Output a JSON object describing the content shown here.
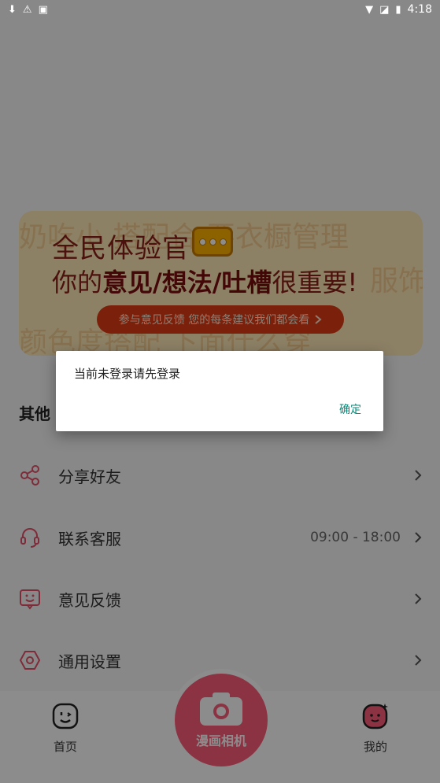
{
  "status_bar": {
    "time": "4:18"
  },
  "banner": {
    "bg_text_1": "奶吃小 搭配合 要衣橱管理",
    "bg_text_2": "颜色度搭配 下面什么穿",
    "bg_text_3": "服饰",
    "title": "全民体验官",
    "subtitle_prefix": "你的",
    "subtitle_emphasis": "意见/想法/吐槽",
    "subtitle_suffix": "很重要!",
    "cta": "参与意见反馈 您的每条建议我们都会看"
  },
  "section": {
    "title": "其他"
  },
  "menu": [
    {
      "label": "分享好友",
      "meta": ""
    },
    {
      "label": "联系客服",
      "meta": "09:00 - 18:00"
    },
    {
      "label": "意见反馈",
      "meta": ""
    },
    {
      "label": "通用设置",
      "meta": ""
    }
  ],
  "bottom_nav": {
    "home": "首页",
    "camera": "漫画相机",
    "mine": "我的"
  },
  "dialog": {
    "message": "当前未登录请先登录",
    "confirm": "确定"
  },
  "colors": {
    "accent": "#ff5d7a",
    "menu_icon": "#e8506b",
    "dialog_button": "#0a8a7a"
  }
}
